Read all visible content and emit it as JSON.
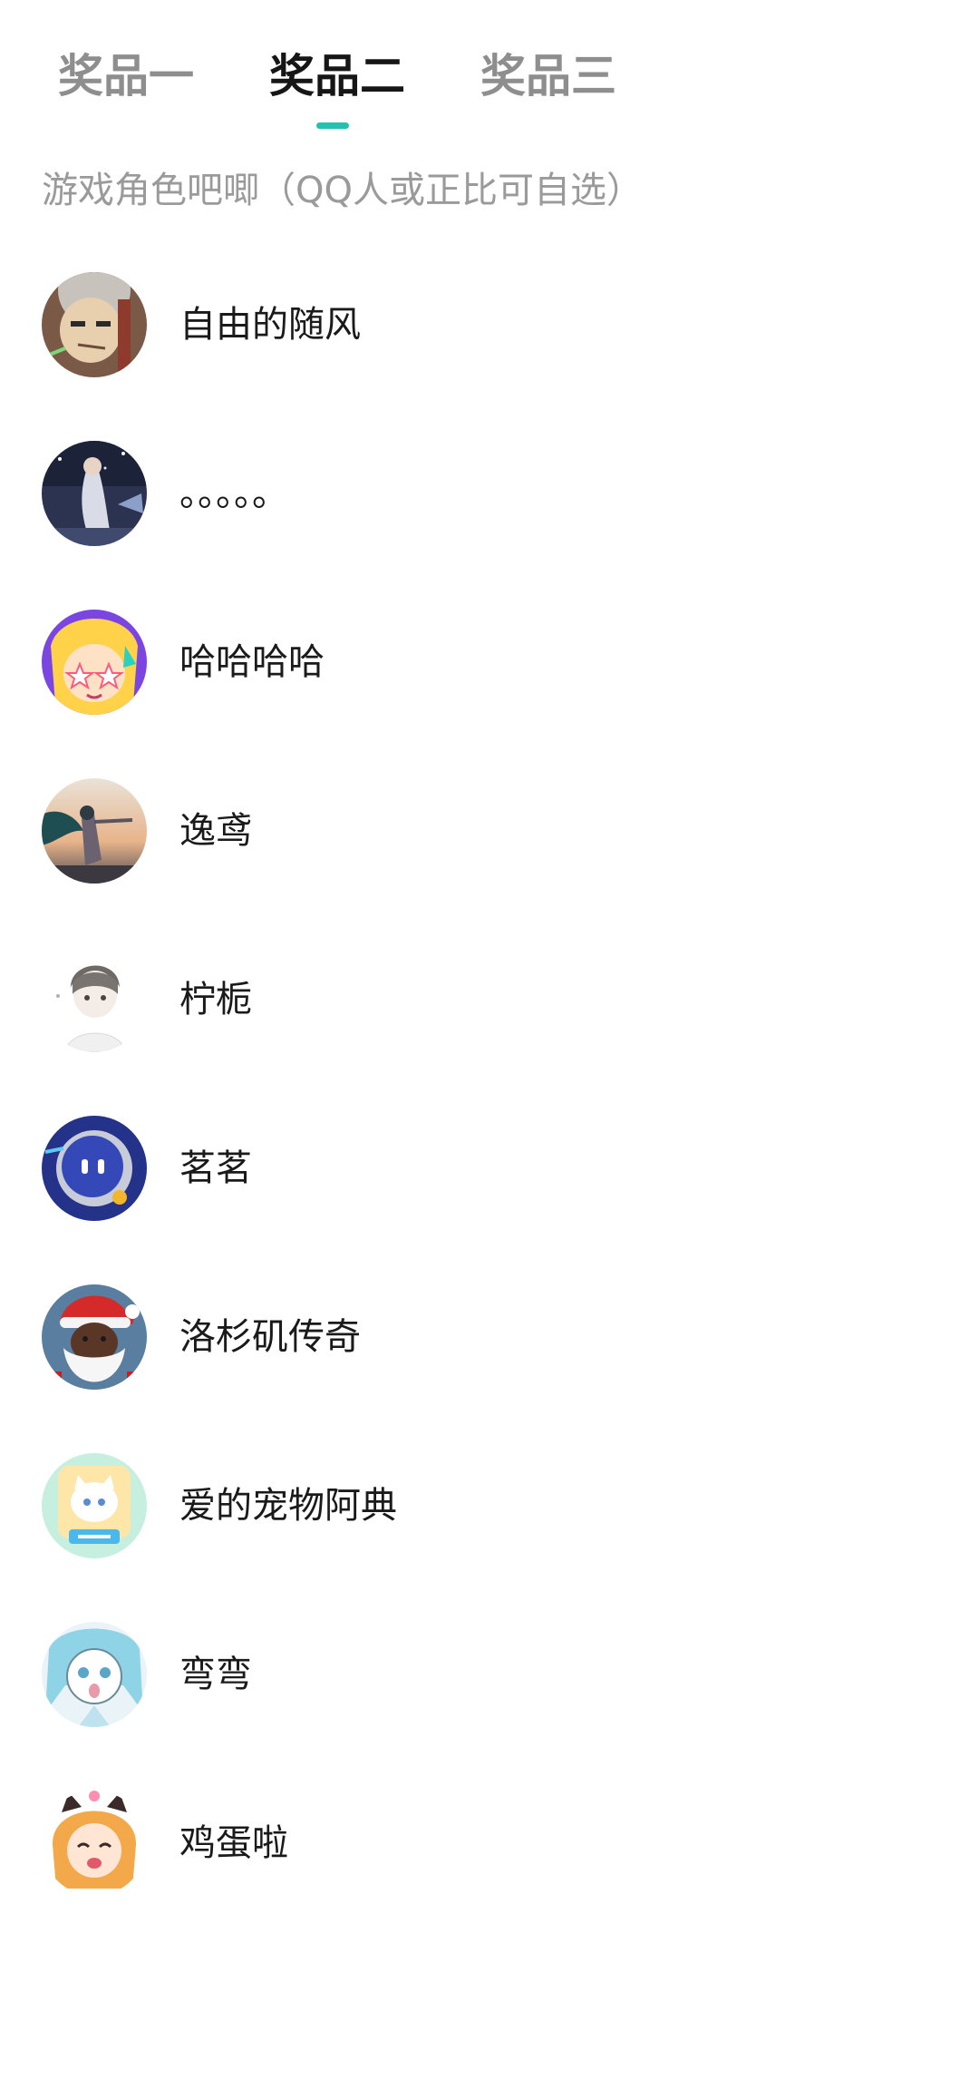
{
  "tabs": [
    {
      "label": "奖品一",
      "active": false
    },
    {
      "label": "奖品二",
      "active": true
    },
    {
      "label": "奖品三",
      "active": false
    }
  ],
  "accent_color": "#21c2b0",
  "prize_description": "游戏角色吧唧（QQ人或正比可自选）",
  "winners": [
    {
      "name": "自由的随风",
      "avatar": "anime-character-avatar"
    },
    {
      "name": "。。。。。",
      "avatar": "night-scene-avatar"
    },
    {
      "name": "哈哈哈哈",
      "avatar": "star-eyed-character-avatar"
    },
    {
      "name": "逸鸢",
      "avatar": "sunset-figure-avatar"
    },
    {
      "name": "柠栀",
      "avatar": "sketch-boy-avatar"
    },
    {
      "name": "茗茗",
      "avatar": "robot-avatar"
    },
    {
      "name": "洛杉矶传奇",
      "avatar": "santa-avatar"
    },
    {
      "name": "爱的宠物阿典",
      "avatar": "cat-avatar"
    },
    {
      "name": "弯弯",
      "avatar": "blue-hair-character-avatar"
    },
    {
      "name": "鸡蛋啦",
      "avatar": "cat-ear-girl-avatar"
    }
  ]
}
